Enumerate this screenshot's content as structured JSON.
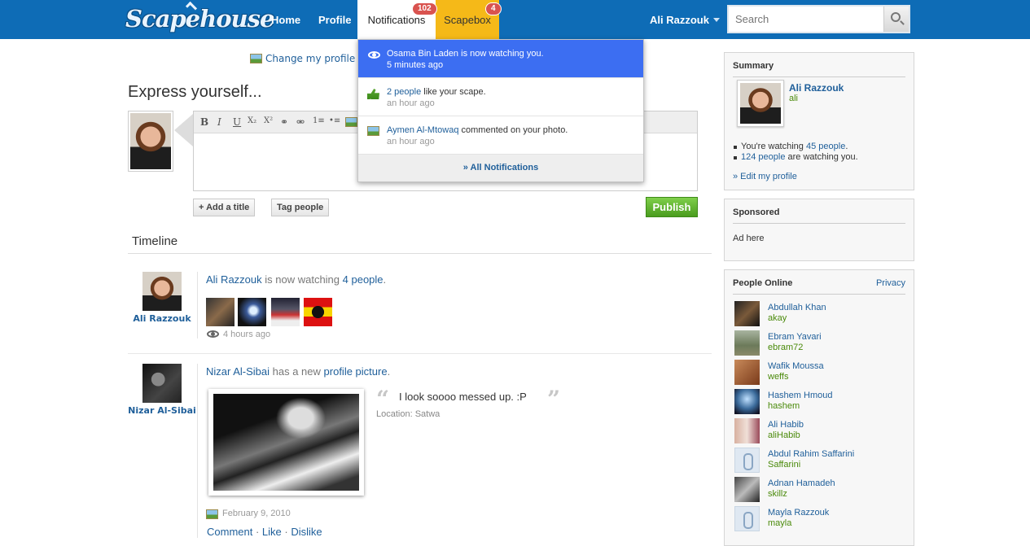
{
  "header": {
    "logo": "Scapehouse",
    "nav": {
      "home": "Home",
      "profile": "Profile",
      "notifications": "Notifications",
      "scapebox": "Scapebox"
    },
    "badges": {
      "notifications": "102",
      "scapebox": "4"
    },
    "user_name": "Ali Razzouk",
    "search_placeholder": "Search"
  },
  "composer": {
    "change_picture": "Change my profile pi",
    "heading": "Express yourself...",
    "toolbar": [
      "B",
      "I",
      "U",
      "X₂",
      "X²",
      "⚭",
      "⚮",
      "1≡",
      "•≡"
    ],
    "add_title": "+ Add a title",
    "tag_people": "Tag people",
    "publish": "Publish"
  },
  "timeline": {
    "heading": "Timeline",
    "posts": [
      {
        "author": "Ali Razzouk",
        "actor": "Ali Razzouk",
        "verb": " is now watching ",
        "object": "4 people",
        "tail": ".",
        "time": "4 hours ago"
      },
      {
        "author": "Nizar Al-Sibai",
        "actor": "Nizar Al-Sibai",
        "verb": " has a new ",
        "object": "profile picture",
        "tail": ".",
        "quote": "I look soooo messed up. :P",
        "location": "Location: Satwa",
        "date": "February 9, 2010",
        "actions": {
          "comment": "Comment",
          "like": "Like",
          "dislike": "Dislike",
          "sep": " · "
        }
      }
    ]
  },
  "notifications": {
    "items": [
      {
        "link": "Osama Bin Laden",
        "text": " is now watching you.",
        "time": "5 minutes ago",
        "icon": "eye-icon"
      },
      {
        "link": "2 people",
        "text": " like your scape.",
        "time": "an hour ago",
        "icon": "thumbs-up-icon"
      },
      {
        "link": "Aymen Al-Mtowaq",
        "text": " commented on your photo.",
        "time": "an hour ago",
        "icon": "photo-icon"
      }
    ],
    "footer": "» All Notifications"
  },
  "sidebar": {
    "summary": {
      "title": "Summary",
      "name": "Ali Razzouk",
      "username": "ali",
      "watching_pre": "You're watching ",
      "watching_link": "45 people",
      "watching_post": ".",
      "watchers_link": "124 people",
      "watchers_post": " are watching you.",
      "edit": "» Edit my profile"
    },
    "sponsored": {
      "title": "Sponsored",
      "text": "Ad here"
    },
    "online": {
      "title": "People Online",
      "privacy": "Privacy",
      "people": [
        {
          "name": "Abdullah Khan",
          "user": "akay"
        },
        {
          "name": "Ebram Yavari",
          "user": "ebram72"
        },
        {
          "name": "Wafik Moussa",
          "user": "weffs"
        },
        {
          "name": "Hashem Hmoud",
          "user": "hashem"
        },
        {
          "name": "Ali Habib",
          "user": "aliHabib"
        },
        {
          "name": "Abdul Rahim Saffarini",
          "user": "Saffarini"
        },
        {
          "name": "Adnan Hamadeh",
          "user": "skillz"
        },
        {
          "name": "Mayla Razzouk",
          "user": "mayla"
        }
      ]
    }
  },
  "colors": {
    "topbar": "#0e6cb6",
    "scapebox": "#f5b918",
    "active_notification": "#3c6ef2",
    "publish": "#4a9c1e",
    "link": "#1f5f9a",
    "username": "#4a8a0a"
  }
}
